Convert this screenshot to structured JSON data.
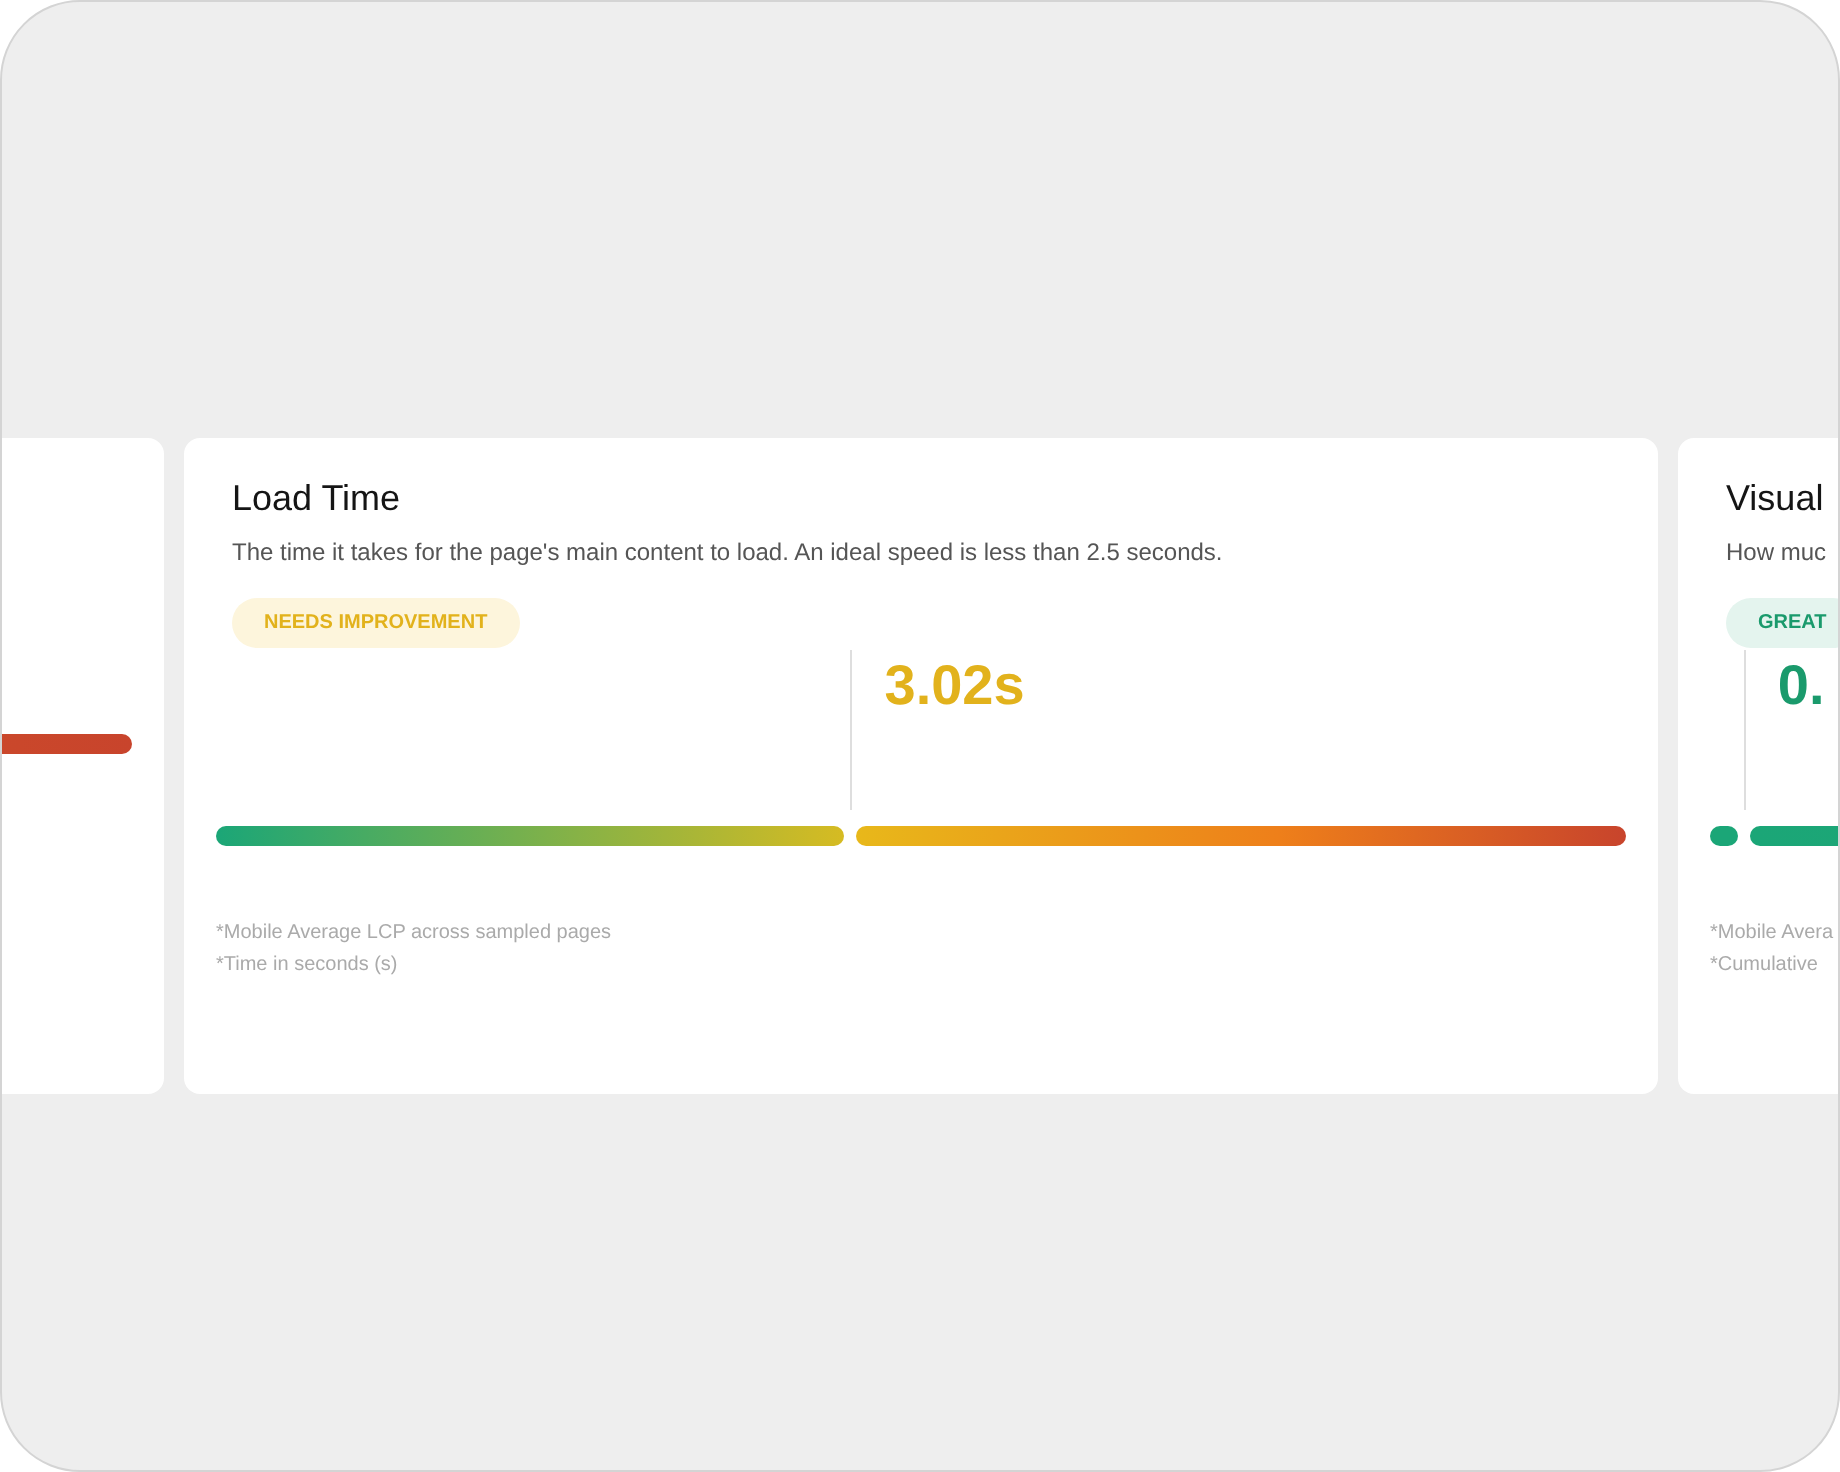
{
  "cards": [
    {
      "kind": "poor"
    },
    {
      "kind": "needs_improvement",
      "title": "Load Time",
      "description": "The time it takes for the page's main content to load. An ideal speed is less than 2.5 seconds.",
      "badge": "NEEDS IMPROVEMENT",
      "value": "3.02s",
      "level": 0.45,
      "notes": [
        "*Mobile Average LCP across sampled pages",
        "*Time in seconds (s)"
      ]
    },
    {
      "kind": "great",
      "title": "Visual",
      "description": "How muc",
      "badge": "GREAT",
      "value": "0.",
      "level": 0.024,
      "notes": [
        "*Mobile Avera",
        "*Cumulative"
      ]
    }
  ]
}
